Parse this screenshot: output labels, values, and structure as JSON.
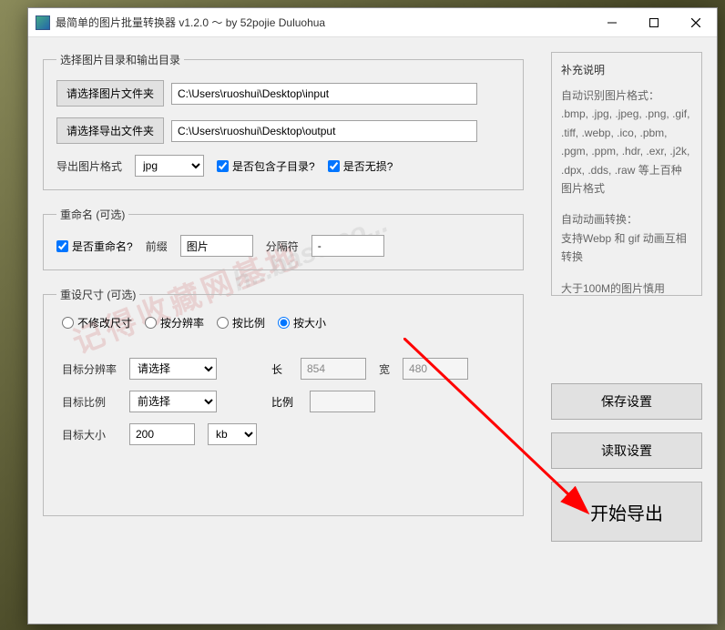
{
  "window": {
    "title": "最简单的图片批量转换器 v1.2.0 ～ by 52pojie Duluohua"
  },
  "folders": {
    "legend": "选择图片目录和输出目录",
    "pickInputBtn": "请选择图片文件夹",
    "inputPath": "C:\\Users\\ruoshui\\Desktop\\input",
    "pickOutputBtn": "请选择导出文件夹",
    "outputPath": "C:\\Users\\ruoshui\\Desktop\\output",
    "exportFmtLabel": "导出图片格式",
    "exportFmtValue": "jpg",
    "includeSubLabel": "是否包含子目录?",
    "losslessLabel": "是否无损?"
  },
  "rename": {
    "legend": "重命名 (可选)",
    "enableLabel": "是否重命名?",
    "prefixLabel": "前缀",
    "prefixValue": "图片",
    "sepLabel": "分隔符",
    "sepValue": "-"
  },
  "resize": {
    "legend": "重设尺寸 (可选)",
    "modes": {
      "none": "不修改尺寸",
      "byRes": "按分辨率",
      "byRatio": "按比例",
      "bySize": "按大小"
    },
    "resLabel": "目标分辨率",
    "resSelectPlaceholder": "请选择",
    "lengthLabel": "长",
    "lengthValue": "854",
    "widthLabel": "宽",
    "widthValue": "480",
    "ratioLabel": "目标比例",
    "ratioSelectPlaceholder": "前选择",
    "ratioSubLabel": "比例",
    "ratioValue": "",
    "sizeLabel": "目标大小",
    "sizeValue": "200",
    "sizeUnit": "kb"
  },
  "side": {
    "infoTitle": "补充说明",
    "infoFormatsTitle": "自动识别图片格式：",
    "infoFormats": ".bmp, .jpg, .jpeg, .png, .gif, .tiff, .webp, .ico, .pbm, .pgm, .ppm, .hdr, .exr, .j2k, .dpx, .dds, .raw 等上百种图片格式",
    "animTitle": "自动动画转换：",
    "animText": "支持Webp 和 gif 动画互相转换",
    "sizeWarn": "大于100M的图片慎用",
    "saveBtn": "保存设置",
    "loadBtn": "读取设置",
    "startBtn": "开始导出"
  },
  "watermark1": "记得收藏网基地",
  "watermark2": "h...base.co..."
}
